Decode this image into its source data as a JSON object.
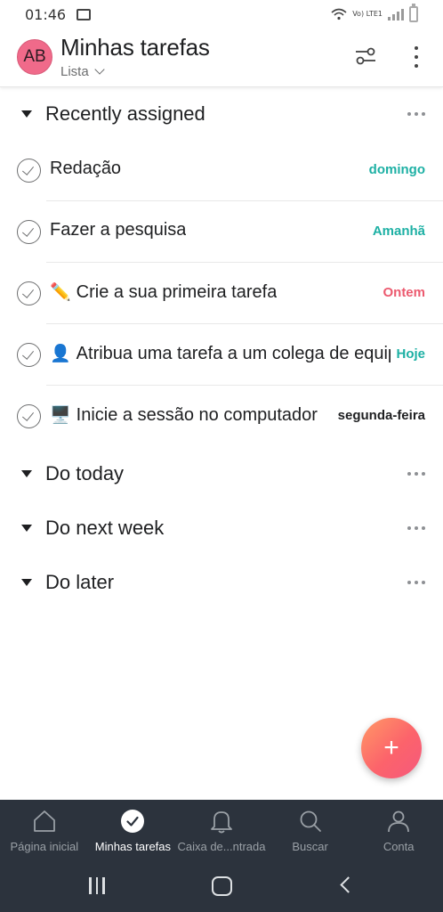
{
  "status_bar": {
    "time": "01:46",
    "network": "Vo) LTE1"
  },
  "header": {
    "avatar_initials": "AB",
    "title": "Minhas tarefas",
    "view_label": "Lista",
    "avatar_color": "#f06a8a"
  },
  "sections": [
    {
      "title": "Recently assigned",
      "tasks": [
        {
          "emoji": "",
          "name": "Redação",
          "due": "domingo",
          "due_color": "#1db0a4"
        },
        {
          "emoji": "",
          "name": "Fazer a pesquisa",
          "due": "Amanhã",
          "due_color": "#1db0a4"
        },
        {
          "emoji": "✏️",
          "name": "Crie a sua primeira tarefa",
          "due": "Ontem",
          "due_color": "#ec5a6f"
        },
        {
          "emoji": "👤",
          "name": "Atribua uma tarefa a um colega de equipe",
          "due": "Hoje",
          "due_color": "#1db0a4"
        },
        {
          "emoji": "🖥️",
          "name": "Inicie a sessão no computador",
          "due": "segunda-feira",
          "due_color": "#1e1f21"
        }
      ]
    },
    {
      "title": "Do today"
    },
    {
      "title": "Do next week"
    },
    {
      "title": "Do later"
    }
  ],
  "fab": {
    "symbol": "+"
  },
  "bottom_nav": {
    "items": [
      {
        "label": "Página inicial",
        "icon": "home-icon",
        "active": false
      },
      {
        "label": "Minhas tarefas",
        "icon": "check-circle-icon",
        "active": true
      },
      {
        "label": "Caixa de...ntrada",
        "icon": "bell-icon",
        "active": false
      },
      {
        "label": "Buscar",
        "icon": "search-icon",
        "active": false
      },
      {
        "label": "Conta",
        "icon": "person-icon",
        "active": false
      }
    ]
  },
  "colors": {
    "accent_teal": "#1db0a4",
    "overdue_red": "#ec5a6f",
    "nav_background": "#2c333d"
  }
}
